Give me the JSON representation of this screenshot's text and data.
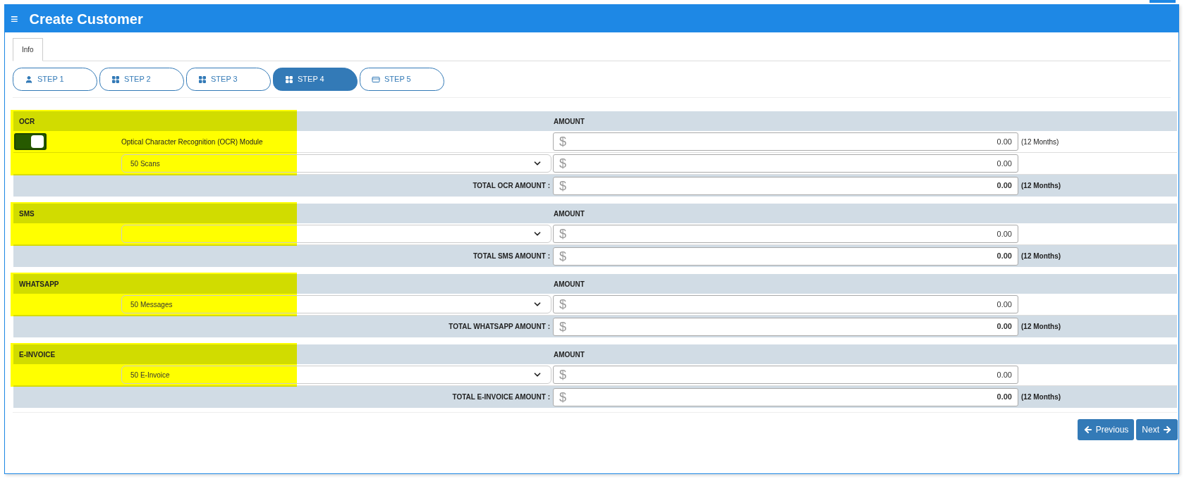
{
  "header": {
    "menu_glyph": "≡",
    "title": "Create Customer"
  },
  "tabs": [
    {
      "label": "Info",
      "selected": true
    }
  ],
  "steps": [
    {
      "label": "STEP 1",
      "kind": "person",
      "selected": false
    },
    {
      "label": "STEP 2",
      "kind": "modules",
      "selected": false
    },
    {
      "label": "STEP 3",
      "kind": "modules",
      "selected": false
    },
    {
      "label": "STEP 4",
      "kind": "modules",
      "selected": true
    },
    {
      "label": "STEP 5",
      "kind": "payment",
      "selected": false
    }
  ],
  "sections": [
    {
      "title": "OCR",
      "amount_heading": "AMOUNT",
      "highlighted": true,
      "rows": [
        {
          "kind": "toggle",
          "on": true,
          "label": "Optical Character Recognition (OCR) Module",
          "currency": "$",
          "amount": "0.00",
          "note": "(12 Months)"
        },
        {
          "kind": "select",
          "value": "50 Scans",
          "currency": "$",
          "amount": "0.00"
        }
      ],
      "total": {
        "label": "TOTAL OCR AMOUNT :",
        "currency": "$",
        "amount": "0.00",
        "note": "(12 Months)"
      }
    },
    {
      "title": "SMS",
      "amount_heading": "AMOUNT",
      "highlighted": true,
      "rows": [
        {
          "kind": "select",
          "currency": "$",
          "amount": "0.00"
        }
      ],
      "total": {
        "label": "TOTAL SMS AMOUNT :",
        "currency": "$",
        "amount": "0.00",
        "note": "(12 Months)"
      }
    },
    {
      "title": "WHATSAPP",
      "amount_heading": "AMOUNT",
      "highlighted": true,
      "rows": [
        {
          "kind": "select",
          "value": "50 Messages",
          "currency": "$",
          "amount": "0.00"
        }
      ],
      "total": {
        "label": "TOTAL WHATSAPP AMOUNT :",
        "currency": "$",
        "amount": "0.00",
        "note": "(12 Months)"
      }
    },
    {
      "title": "E-INVOICE",
      "amount_heading": "AMOUNT",
      "highlighted": true,
      "rows": [
        {
          "kind": "select",
          "value": "50 E-Invoice",
          "currency": "$",
          "amount": "0.00"
        }
      ],
      "total": {
        "label": "TOTAL E-INVOICE AMOUNT :",
        "currency": "$",
        "amount": "0.00",
        "note": "(12 Months)"
      }
    }
  ],
  "buttons": [
    {
      "label": "Previous",
      "kind": "prev"
    },
    {
      "label": "Next",
      "kind": "next"
    }
  ]
}
